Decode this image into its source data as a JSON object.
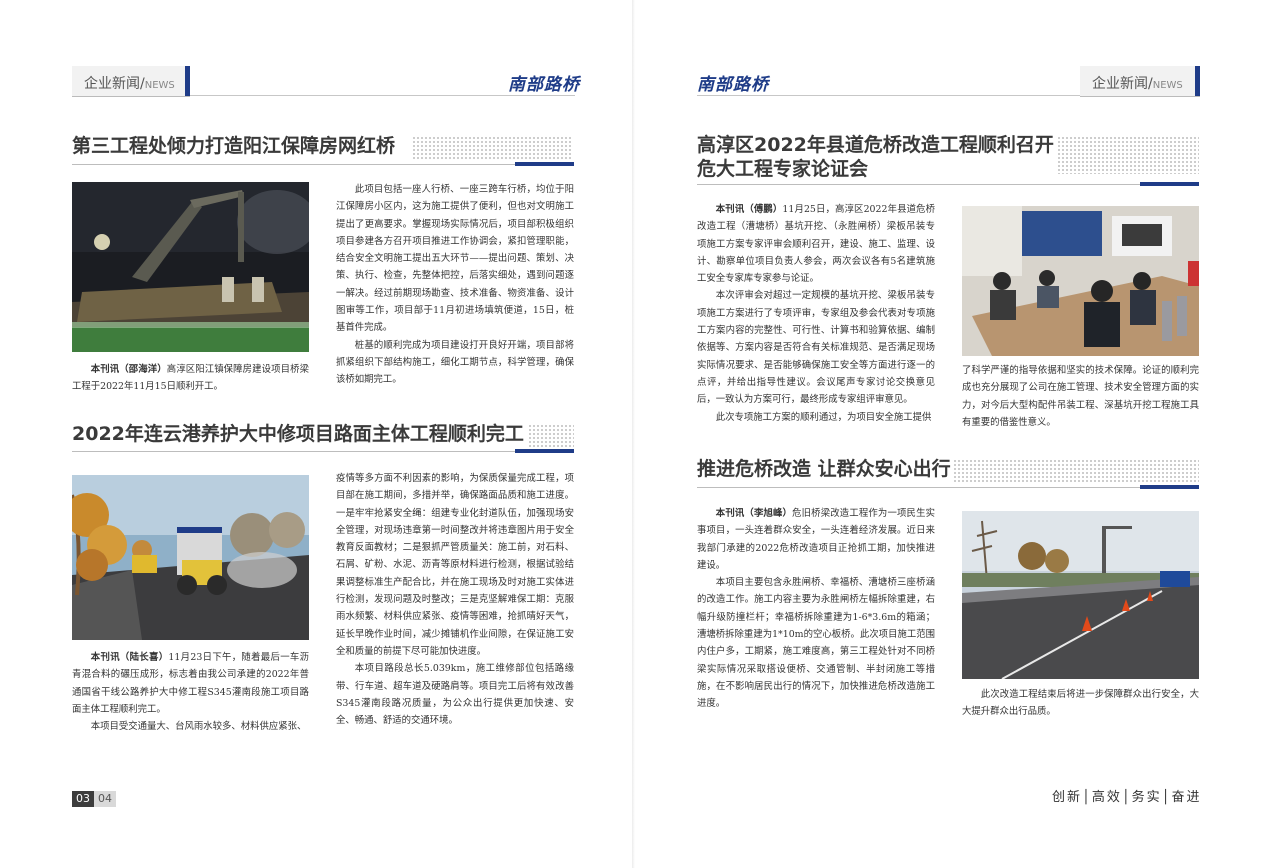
{
  "header": {
    "section_cn": "企业新闻",
    "section_sep": "/",
    "section_en": "NEWS",
    "logo": "南部路桥"
  },
  "left": {
    "article1": {
      "title": "第三工程处倾力打造阳江保障房网红桥",
      "caption_author": "本刊讯（邵海洋）",
      "caption_text": "高淳区阳江镇保障房建设项目桥梁工程于2022年11月15日顺利开工。",
      "p1": "此项目包括一座人行桥、一座三跨车行桥，均位于阳江保障房小区内，这为施工提供了便利，但也对文明施工提出了更高要求。掌握现场实际情况后，项目部积极组织项目参建各方召开项目推进工作协调会，紧扣管理职能，结合安全文明施工提出五大环节——提出问题、策划、决策、执行、检查，先整体把控，后落实细处，遇到问题逐一解决。经过前期现场勘查、技术准备、物资准备、设计图审等工作，项目部于11月初进场填筑便道，15日，桩基首件完成。",
      "p2": "桩基的顺利完成为项目建设打开良好开端，项目部将抓紧组织下部结构施工，细化工期节点，科学管理，确保该桥如期完工。"
    },
    "article2": {
      "title": "2022年连云港养护大中修项目路面主体工程顺利完工",
      "caption_author": "本刊讯（陆长喜）",
      "caption_text": "11月23日下午，随着最后一车沥青混合料的碾压成形，标志着由我公司承建的2022年普通国省干线公路养护大中修工程S345灌南段施工项目路面主体工程顺利完工。",
      "p_left": "本项目受交通量大、台风雨水较多、材料供应紧张、",
      "p1": "疫情等多方面不利因素的影响，为保质保量完成工程，项目部在施工期间，多措并举，确保路面品质和施工进度。一是牢牢抢紧安全绳：组建专业化封道队伍，加强现场安全管理，对现场违章第一时间整改并将违章图片用于安全教育反面教材；二是狠抓严管质量关：施工前，对石料、石屑、矿粉、水泥、沥青等原材料进行检测，根据试验结果调整标准生产配合比，并在施工现场及时对施工实体进行检测，发现问题及时整改；三是克坚解难保工期：克服雨水频繁、材料供应紧张、疫情等困难，抢抓晴好天气，延长早晚作业时间，减少摊铺机作业间隙，在保证施工安全和质量的前提下尽可能加快进度。",
      "p2": "本项目路段总长5.039km，施工维修部位包括路缘带、行车道、超车道及硬路肩等。项目完工后将有效改善S345灌南段路况质量，为公众出行提供更加快速、安全、畅通、舒适的交通环境。"
    },
    "page_current": "03",
    "page_next": "04"
  },
  "right": {
    "article1": {
      "title_line1": "高淳区2022年县道危桥改造工程顺利召开",
      "title_line2": "危大工程专家论证会",
      "author": "本刊讯（傅鹏）",
      "p1_text": "11月25日，高淳区2022年县道危桥改造工程（漕塘桥）基坑开挖、（永胜闸桥）梁板吊装专项施工方案专家评审会顺利召开，建设、施工、监理、设计、勘察单位项目负责人参会，两次会议各有5名建筑施工安全专家库专家参与论证。",
      "p2": "本次评审会对超过一定规模的基坑开挖、梁板吊装专项施工方案进行了专项评审，专家组及参会代表对专项施工方案内容的完整性、可行性、计算书和验算依据、编制依据等、方案内容是否符合有关标准规范、是否满足现场实际情况要求、是否能够确保施工安全等方面进行逐一的点评，并给出指导性建议。会议尾声专家讨论交换意见后，一致认为方案可行，最终形成专家组评审意见。",
      "p3_left": "此次专项施工方案的顺利通过，为项目安全施工提供",
      "p3_right": "了科学严谨的指导依据和坚实的技术保障。论证的顺利完成也充分展现了公司在施工管理、技术安全管理方面的实力，对今后大型构配件吊装工程、深基坑开挖工程施工具有重要的借鉴性意义。"
    },
    "article2": {
      "title": "推进危桥改造 让群众安心出行",
      "author": "本刊讯（李旭峰）",
      "p1_text": "危旧桥梁改造工程作为一项民生实事项目，一头连着群众安全，一头连着经济发展。近日来我部门承建的2022危桥改造项目正抢抓工期，加快推进建设。",
      "p2": "本项目主要包含永胜闸桥、幸福桥、漕塘桥三座桥涵的改造工作。施工内容主要为永胜闸桥左幅拆除重建，右幅升级防撞栏杆；幸福桥拆除重建为1-6*3.6m的箱涵；漕塘桥拆除重建为1*10m的空心板桥。此次项目施工范围内住户多，工期紧，施工难度高，第三工程处针对不同桥梁实际情况采取搭设便桥、交通管制、半封闭施工等措施，在不影响居民出行的情况下，加快推进危桥改造施工进度。",
      "caption": "此次改造工程结束后将进一步保障群众出行安全，大大提升群众出行品质。"
    },
    "slogan": "创新│高效│务实│奋进"
  },
  "colors": {
    "accent": "#1f3c88",
    "title": "#3a3a3a",
    "text": "#333333"
  }
}
